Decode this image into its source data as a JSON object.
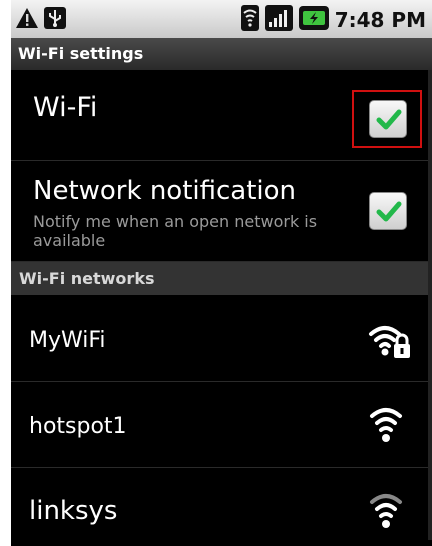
{
  "status_bar": {
    "time": "7:48 PM"
  },
  "title": "Wi-Fi settings",
  "wifi": {
    "label": "Wi-Fi",
    "checked": true
  },
  "network_notification": {
    "label": "Network notification",
    "summary": "Notify me when an open network is available",
    "checked": true
  },
  "networks_header": "Wi-Fi networks",
  "networks": [
    {
      "name": "MyWiFi",
      "secured": true,
      "icon": "wifi-lock-icon"
    },
    {
      "name": "hotspot1",
      "secured": false,
      "icon": "wifi-icon"
    },
    {
      "name": "linksys",
      "secured": false,
      "icon": "wifi-icon"
    }
  ],
  "colors": {
    "checkmark": "#22b84a",
    "focus": "#d01010"
  }
}
